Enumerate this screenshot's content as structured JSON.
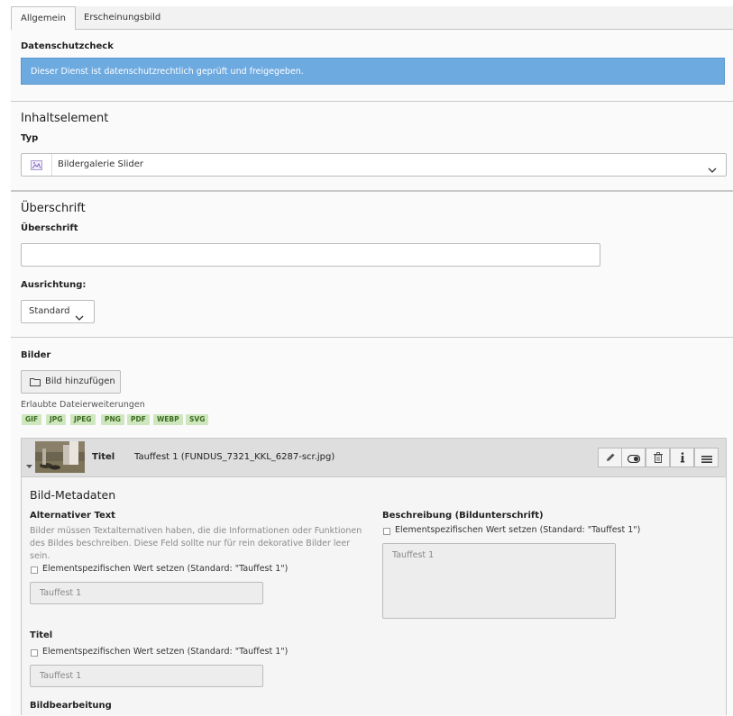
{
  "tabs": [
    {
      "label": "Allgemein",
      "active": true
    },
    {
      "label": "Erscheinungsbild",
      "active": false
    }
  ],
  "privacy": {
    "label": "Datenschutzcheck",
    "message": "Dieser Dienst ist datenschutzrechtlich geprüft und freigegeben."
  },
  "content_element": {
    "section_title": "Inhaltselement",
    "type_label": "Typ",
    "type_value": "Bildergalerie Slider"
  },
  "heading": {
    "section_title": "Überschrift",
    "field_label": "Überschrift",
    "field_value": "",
    "alignment_label": "Ausrichtung:",
    "alignment_value": "Standard"
  },
  "images": {
    "label": "Bilder",
    "add_button": "Bild hinzufügen",
    "allowed_label": "Erlaubte Dateierweiterungen",
    "extensions": [
      "GIF",
      "JPG",
      "JPEG",
      "PNG",
      "PDF",
      "WEBP",
      "SVG"
    ]
  },
  "file_item": {
    "title_label": "Titel",
    "filename": "Tauffest 1 (FUNDUS_7321_KKL_6287-scr.jpg)",
    "actions": [
      "edit-icon",
      "toggle-icon",
      "trash-icon",
      "info-icon",
      "drag-handle-icon"
    ],
    "metadata_title": "Bild-Metadaten",
    "alt_label": "Alternativer Text",
    "alt_help": "Bilder müssen Textalternativen haben, die die Informationen oder Funktionen des Bildes beschreiben. Diese Feld sollte nur für rein dekorative Bilder leer sein.",
    "alt_override": "Elementspezifischen Wert setzen (Standard: \"Tauffest 1\")",
    "alt_value": "Tauffest 1",
    "desc_label": "Beschreibung (Bildunterschrift)",
    "desc_override": "Elementspezifischen Wert setzen (Standard: \"Tauffest 1\")",
    "desc_value": "Tauffest 1",
    "title_field_label": "Titel",
    "title_override": "Elementspezifischen Wert setzen (Standard: \"Tauffest 1\")",
    "title_value": "Tauffest 1",
    "processing_label": "Bildbearbeitung"
  },
  "colors": {
    "info_blue": "#6daae0",
    "chip_green": "#cfe7be",
    "chip_text": "#3c6b21"
  }
}
